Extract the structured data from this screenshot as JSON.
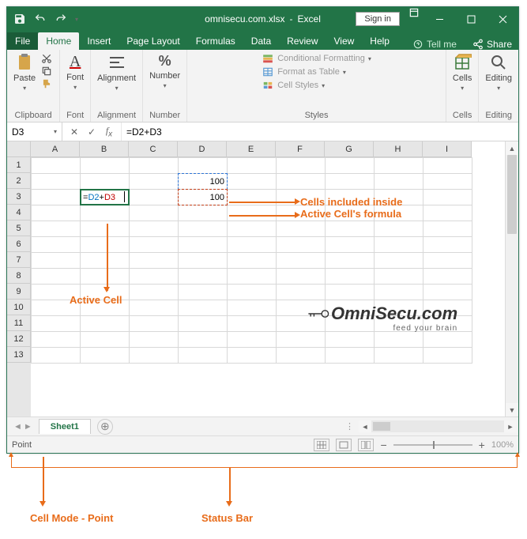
{
  "titlebar": {
    "filename": "omnisecu.com.xlsx",
    "app": "Excel",
    "signin": "Sign in"
  },
  "tabs": {
    "file": "File",
    "home": "Home",
    "insert": "Insert",
    "page_layout": "Page Layout",
    "formulas": "Formulas",
    "data": "Data",
    "review": "Review",
    "view": "View",
    "help": "Help",
    "tell_me": "Tell me",
    "share": "Share"
  },
  "ribbon": {
    "paste": "Paste",
    "clipboard": "Clipboard",
    "font_group": "Font",
    "font_btn": "Font",
    "alignment": "Alignment",
    "number": "Number",
    "percent": "%",
    "cond_fmt": "Conditional Formatting",
    "fmt_table": "Format as Table",
    "cell_styles": "Cell Styles",
    "styles": "Styles",
    "cells": "Cells",
    "editing": "Editing"
  },
  "formula_bar": {
    "name_box": "D3",
    "formula": "=D2+D3"
  },
  "grid": {
    "columns": [
      "A",
      "B",
      "C",
      "D",
      "E",
      "F",
      "G",
      "H",
      "I"
    ],
    "rows": [
      "1",
      "2",
      "3",
      "4",
      "5",
      "6",
      "7",
      "8",
      "9",
      "10",
      "11",
      "12",
      "13"
    ],
    "d2": "100",
    "d3": "100",
    "b3_prefix": "=",
    "b3_blue": "D2",
    "b3_plus": "+",
    "b3_red": "D3"
  },
  "sheets": {
    "sheet1": "Sheet1"
  },
  "status": {
    "mode": "Point",
    "zoom": "100%",
    "minus": "−",
    "plus": "+"
  },
  "annotations": {
    "cells_included_1": "Cells included inside",
    "cells_included_2": "Active Cell's formula",
    "active_cell": "Active Cell",
    "cell_mode": "Cell Mode - Point",
    "status_bar": "Status Bar"
  },
  "logo": {
    "main": "OmniSecu.com",
    "sub": "feed your brain"
  }
}
